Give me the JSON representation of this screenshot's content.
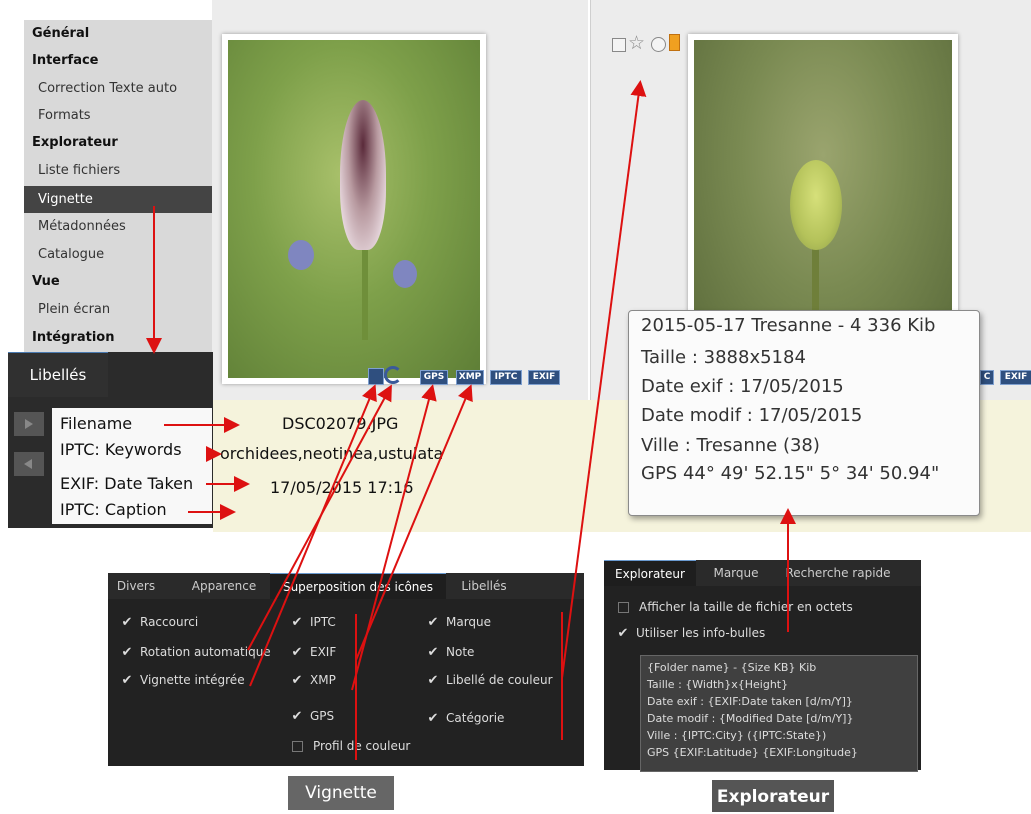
{
  "options_tree": {
    "items": [
      {
        "label": "Général",
        "kind": "bold"
      },
      {
        "label": "Interface",
        "kind": "bold"
      },
      {
        "label": "Correction Texte auto",
        "kind": "sub"
      },
      {
        "label": "Formats",
        "kind": "sub"
      },
      {
        "label": "Explorateur",
        "kind": "bold"
      },
      {
        "label": "Liste fichiers",
        "kind": "sub"
      },
      {
        "label": "Vignette",
        "kind": "sub",
        "selected": true
      },
      {
        "label": "Métadonnées",
        "kind": "sub"
      },
      {
        "label": "Catalogue",
        "kind": "sub"
      },
      {
        "label": "Vue",
        "kind": "bold"
      },
      {
        "label": "Plein écran",
        "kind": "sub"
      },
      {
        "label": "Intégration",
        "kind": "bold"
      }
    ]
  },
  "thumbnail_overlay_icons": [
    "GPS",
    "XMP",
    "IPTC",
    "EXIF"
  ],
  "thumbnail2_overlay_icons": [
    "C",
    "EXIF"
  ],
  "libelles_panel": {
    "tab_label": "Libellés",
    "rows": [
      {
        "label": "Filename",
        "value": "DSC02079.JPG"
      },
      {
        "label": "IPTC: Keywords",
        "value": "orchidees,neotinea,ustulata"
      },
      {
        "label": "EXIF: Date Taken",
        "value": "17/05/2015 17:16"
      },
      {
        "label": "IPTC: Caption",
        "value": ""
      }
    ]
  },
  "tooltip": {
    "lines": [
      "2015-05-17 Tresanne - 4 336 Kib",
      "Taille : 3888x5184",
      "Date exif : 17/05/2015",
      "Date modif : 17/05/2015",
      "Ville : Tresanne (38)",
      "GPS 44° 49' 52.15\" 5° 34' 50.94\""
    ]
  },
  "vignette_dialog": {
    "tabs": [
      "Divers",
      "Apparence",
      "Superposition des icônes",
      "Libellés"
    ],
    "active_tab": 2,
    "col1": [
      {
        "label": "Raccourci",
        "checked": true
      },
      {
        "label": "Rotation automatique",
        "checked": true
      },
      {
        "label": "Vignette intégrée",
        "checked": true
      }
    ],
    "col2": [
      {
        "label": "IPTC",
        "checked": true
      },
      {
        "label": "EXIF",
        "checked": true
      },
      {
        "label": "XMP",
        "checked": true
      },
      {
        "label": "GPS",
        "checked": true
      },
      {
        "label": "Profil de couleur",
        "checked": false
      }
    ],
    "col3": [
      {
        "label": "Marque",
        "checked": true
      },
      {
        "label": "Note",
        "checked": true
      },
      {
        "label": "Libellé de couleur",
        "checked": true
      },
      {
        "label": "Catégorie",
        "checked": true
      }
    ]
  },
  "explorateur_dialog": {
    "tabs": [
      "Explorateur",
      "Marque",
      "Recherche rapide"
    ],
    "active_tab": 0,
    "options": [
      {
        "label": "Afficher la taille de fichier en octets",
        "checked": false
      },
      {
        "label": "Utiliser les info-bulles",
        "checked": true
      }
    ],
    "template_lines": [
      "{Folder name} - {Size KB} Kib",
      "Taille : {Width}x{Height}",
      "Date exif : {EXIF:Date taken [d/m/Y]}",
      "Date modif : {Modified Date [d/m/Y]}",
      "Ville : {IPTC:City} ({IPTC:State})",
      "GPS  {EXIF:Latitude}  {EXIF:Longitude}"
    ]
  },
  "captions": {
    "vignette": "Vignette",
    "explorateur": "Explorateur"
  },
  "colors": {
    "arrow": "#dd1111",
    "panel_dark": "#2a2a2a",
    "selection": "#444444",
    "label_band": "#f5f3dc"
  },
  "icons": [
    "checkbox-icon",
    "star-icon",
    "circle-icon",
    "bookmark-icon",
    "rotate-icon",
    "film-icon"
  ]
}
